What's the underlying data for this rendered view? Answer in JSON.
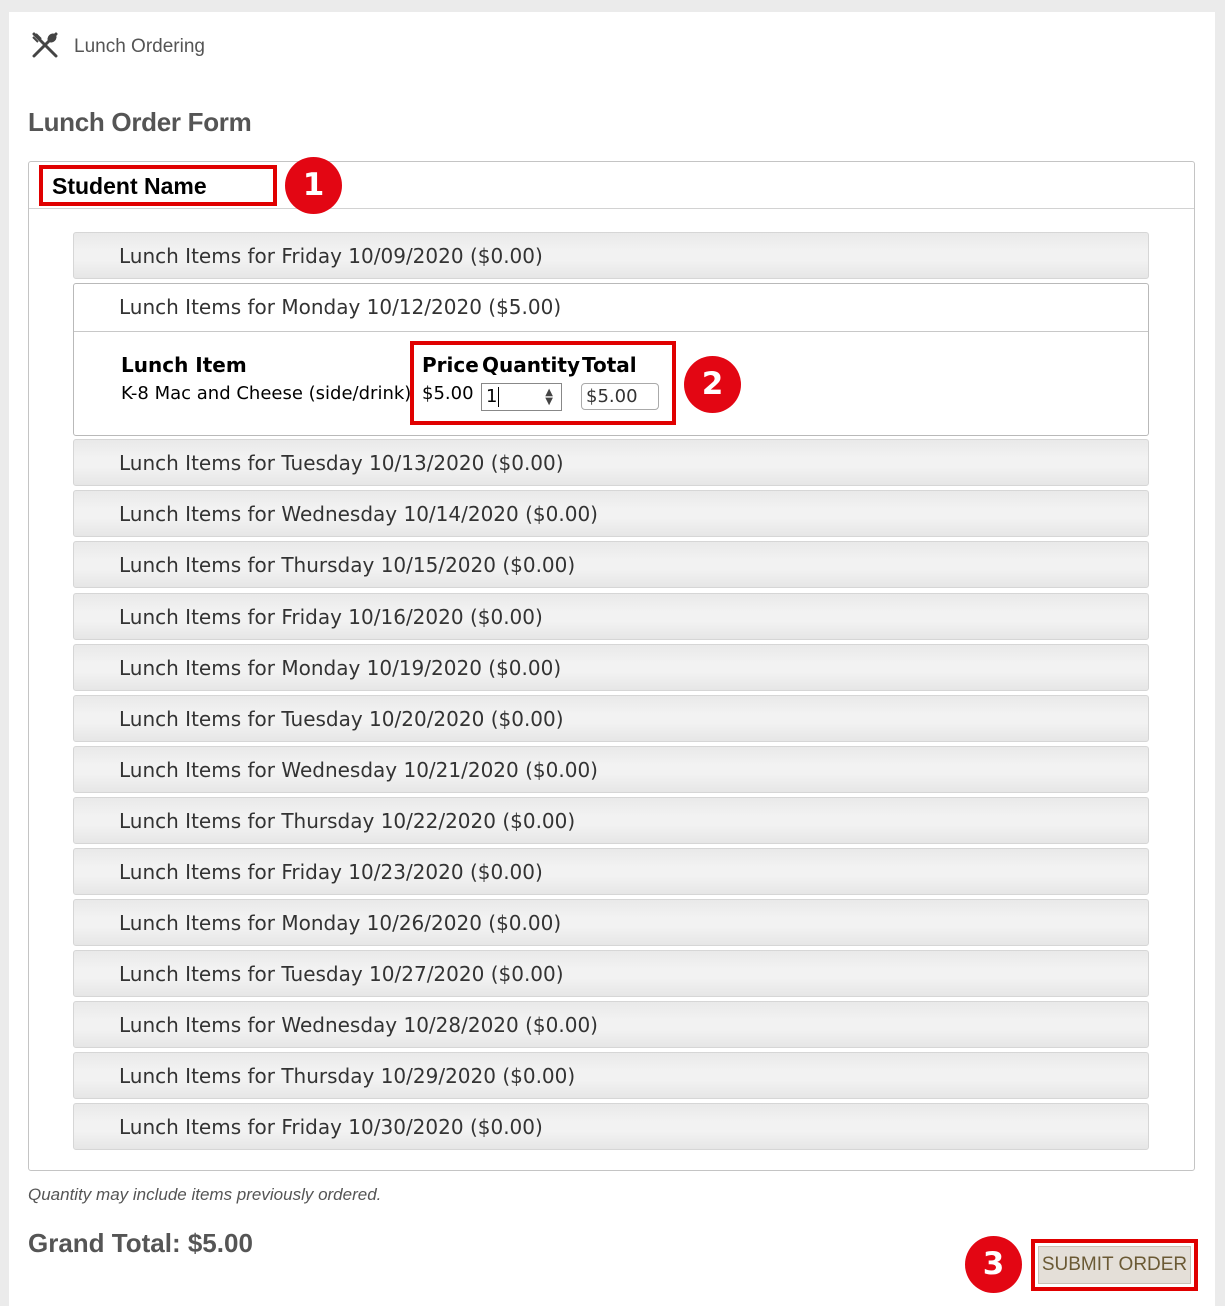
{
  "app": {
    "title": "Lunch Ordering",
    "icon": "utensils-icon"
  },
  "form": {
    "title": "Lunch Order Form"
  },
  "student": {
    "name": "Student Name"
  },
  "badges": [
    "1",
    "2",
    "3"
  ],
  "days": [
    "Lunch Items for Friday 10/09/2020 ($0.00)",
    "Lunch Items for Monday 10/12/2020 ($5.00)",
    "Lunch Items for Tuesday 10/13/2020 ($0.00)",
    "Lunch Items for Wednesday 10/14/2020 ($0.00)",
    "Lunch Items for Thursday 10/15/2020 ($0.00)",
    "Lunch Items for Friday 10/16/2020 ($0.00)",
    "Lunch Items for Monday 10/19/2020 ($0.00)",
    "Lunch Items for Tuesday 10/20/2020 ($0.00)",
    "Lunch Items for Wednesday 10/21/2020 ($0.00)",
    "Lunch Items for Thursday 10/22/2020 ($0.00)",
    "Lunch Items for Friday 10/23/2020 ($0.00)",
    "Lunch Items for Monday 10/26/2020 ($0.00)",
    "Lunch Items for Tuesday 10/27/2020 ($0.00)",
    "Lunch Items for Wednesday 10/28/2020 ($0.00)",
    "Lunch Items for Thursday 10/29/2020 ($0.00)",
    "Lunch Items for Friday 10/30/2020 ($0.00)"
  ],
  "expanded": {
    "headers": {
      "item": "Lunch Item",
      "price": "Price",
      "quantity": "Quantity",
      "total": "Total"
    },
    "row": {
      "item": "K-8 Mac and Cheese (side/drink)",
      "price": "$5.00",
      "quantity": "1",
      "total": "$5.00"
    }
  },
  "footer": {
    "note": "Quantity may include items previously ordered.",
    "grand_total": "Grand Total: $5.00",
    "submit_label": "SUBMIT ORDER"
  },
  "colors": {
    "highlight": "#e00000",
    "badge": "#e30613",
    "submit_bg": "#e4dfd8",
    "submit_text": "#6b5a35"
  }
}
